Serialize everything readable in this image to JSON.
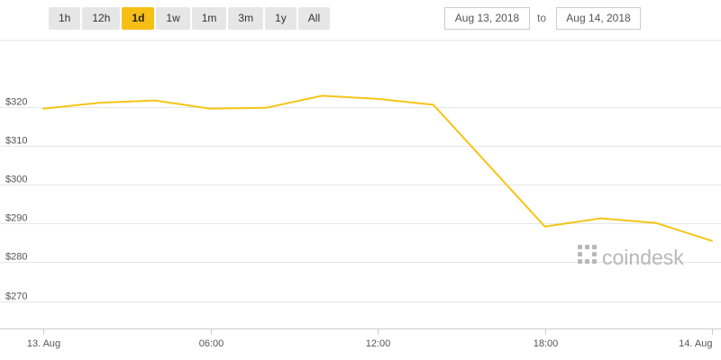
{
  "range_buttons": [
    {
      "label": "1h"
    },
    {
      "label": "12h"
    },
    {
      "label": "1d"
    },
    {
      "label": "1w"
    },
    {
      "label": "1m"
    },
    {
      "label": "3m"
    },
    {
      "label": "1y"
    },
    {
      "label": "All"
    }
  ],
  "active_range": "1d",
  "date_range": {
    "from": "Aug 13, 2018",
    "separator": "to",
    "to": "Aug 14, 2018"
  },
  "watermark": "coindesk",
  "colors": {
    "line": "#f5c518",
    "active_button": "#f7be16",
    "grid": "#e6e6e6",
    "watermark": "#b8b8b8"
  },
  "chart_data": {
    "type": "line",
    "title": "",
    "xlabel": "",
    "ylabel": "",
    "grid": true,
    "x_ticks": [
      {
        "label": "13. Aug",
        "value": "2018-08-13T00:00"
      },
      {
        "label": "06:00",
        "value": "2018-08-13T06:00"
      },
      {
        "label": "12:00",
        "value": "2018-08-13T12:00"
      },
      {
        "label": "18:00",
        "value": "2018-08-13T18:00"
      },
      {
        "label": "14. Aug",
        "value": "2018-08-14T00:00"
      }
    ],
    "xlim": [
      "2018-08-13T00:00",
      "2018-08-14T00:00"
    ],
    "y_ticks": [
      {
        "label": "$270",
        "value": 270
      },
      {
        "label": "$280",
        "value": 280
      },
      {
        "label": "$290",
        "value": 290
      },
      {
        "label": "$300",
        "value": 300
      },
      {
        "label": "$310",
        "value": 310
      },
      {
        "label": "$320",
        "value": 320
      }
    ],
    "ylim": [
      263,
      337
    ],
    "series": [
      {
        "x": [
          "2018-08-13T00:00",
          "2018-08-13T02:00",
          "2018-08-13T04:00",
          "2018-08-13T06:00",
          "2018-08-13T08:00",
          "2018-08-13T10:00",
          "2018-08-13T12:00",
          "2018-08-13T14:00",
          "2018-08-13T18:00",
          "2018-08-13T20:00",
          "2018-08-13T22:00",
          "2018-08-14T00:00"
        ],
        "y": [
          319.5,
          321.0,
          321.6,
          319.5,
          319.7,
          322.8,
          322.0,
          320.5,
          289.2,
          291.3,
          290.1,
          285.5
        ]
      }
    ]
  }
}
